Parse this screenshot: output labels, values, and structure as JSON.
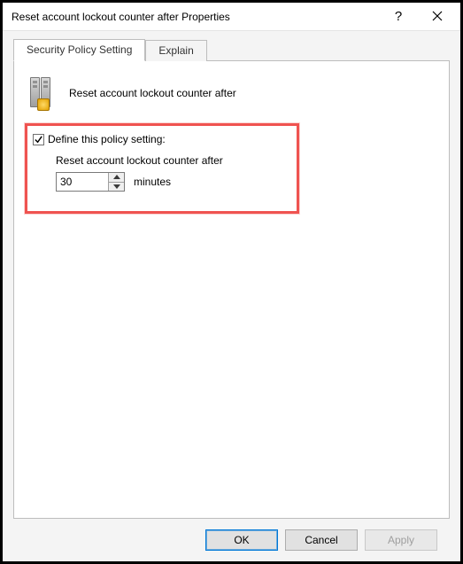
{
  "titlebar": {
    "title": "Reset account lockout counter after Properties"
  },
  "tabs": {
    "policy": "Security Policy Setting",
    "explain": "Explain"
  },
  "policy": {
    "name": "Reset account lockout counter after"
  },
  "define": {
    "checkbox_label": "Define this policy setting:",
    "nested_label": "Reset account lockout counter after",
    "value": "30",
    "units": "minutes",
    "checked": true
  },
  "buttons": {
    "ok": "OK",
    "cancel": "Cancel",
    "apply": "Apply"
  }
}
